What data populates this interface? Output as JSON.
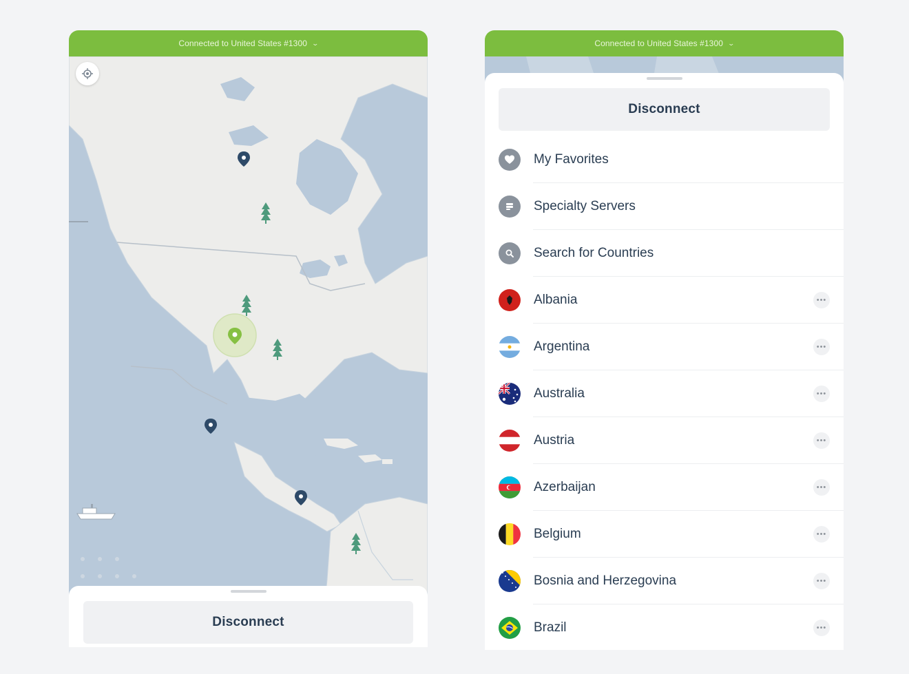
{
  "status_text": "Connected to United States #1300",
  "left": {
    "disconnect_label": "Disconnect"
  },
  "right": {
    "disconnect_label": "Disconnect",
    "menu": [
      {
        "label": "My Favorites",
        "icon": "heart-icon"
      },
      {
        "label": "Specialty Servers",
        "icon": "server-icon"
      },
      {
        "label": "Search for Countries",
        "icon": "search-icon"
      }
    ],
    "countries": [
      {
        "name": "Albania",
        "flag": "flag-albania-icon"
      },
      {
        "name": "Argentina",
        "flag": "flag-argentina-icon"
      },
      {
        "name": "Australia",
        "flag": "flag-australia-icon"
      },
      {
        "name": "Austria",
        "flag": "flag-austria-icon"
      },
      {
        "name": "Azerbaijan",
        "flag": "flag-azerbaijan-icon"
      },
      {
        "name": "Belgium",
        "flag": "flag-belgium-icon"
      },
      {
        "name": "Bosnia and Herzegovina",
        "flag": "flag-bosnia-icon"
      },
      {
        "name": "Brazil",
        "flag": "flag-brazil-icon"
      }
    ],
    "more_glyph": "•••"
  },
  "colors": {
    "accent_green": "#7cbd3f",
    "water": "#b8c9da",
    "land": "#ededeb",
    "text": "#2a3d52",
    "pin_blue": "#2e4a68",
    "pin_green": "#86c043"
  }
}
